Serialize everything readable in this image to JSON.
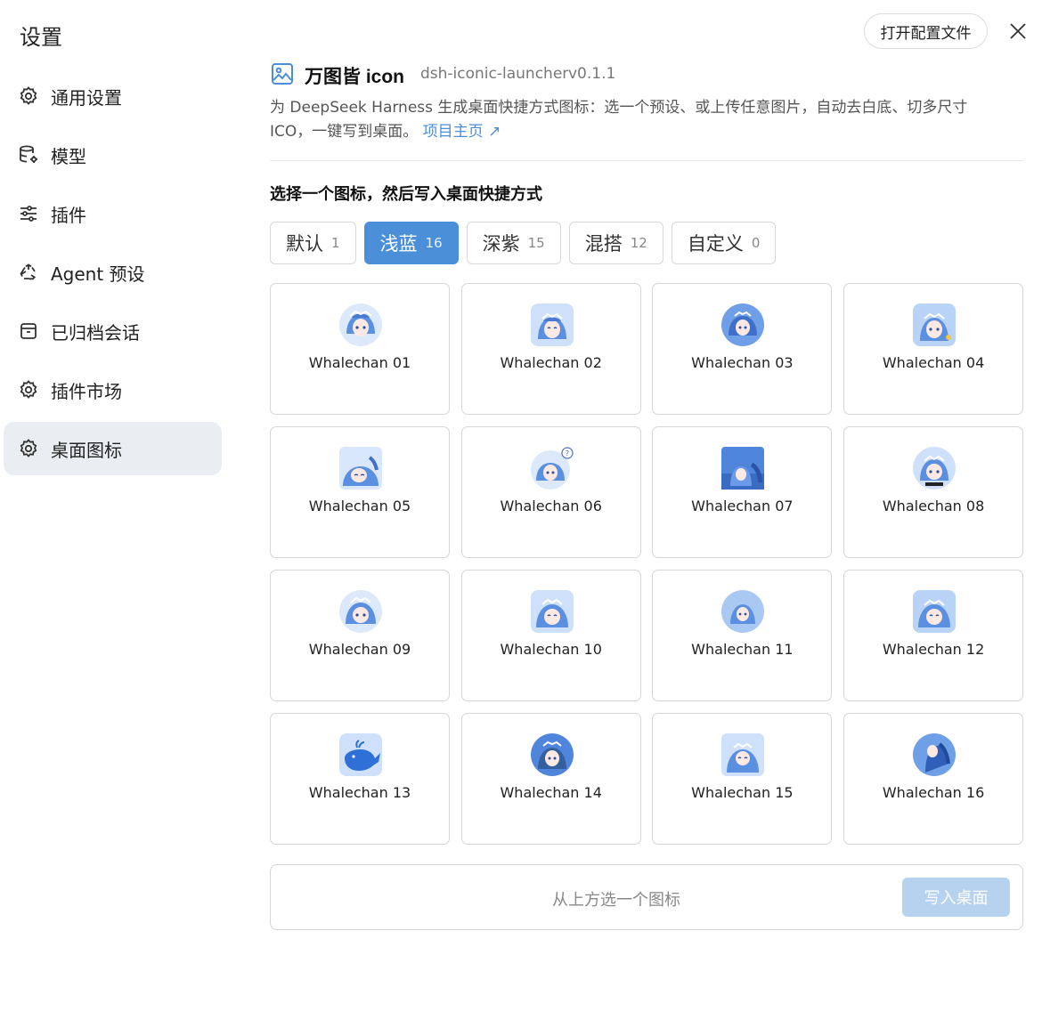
{
  "settings": {
    "title": "设置"
  },
  "sidebar": {
    "items": [
      {
        "label": "通用设置",
        "icon": "gear-icon"
      },
      {
        "label": "模型",
        "icon": "database-gear-icon"
      },
      {
        "label": "插件",
        "icon": "sliders-icon"
      },
      {
        "label": "Agent 预设",
        "icon": "recycle-icon"
      },
      {
        "label": "已归档会话",
        "icon": "archive-icon"
      },
      {
        "label": "插件市场",
        "icon": "gear-icon"
      },
      {
        "label": "桌面图标",
        "icon": "gear-icon",
        "active": true
      }
    ]
  },
  "toolbar": {
    "open_config_label": "打开配置文件"
  },
  "plugin": {
    "name": "万图皆 icon",
    "id": "dsh-iconic-launcher",
    "version": "v0.1.1",
    "description": "为 DeepSeek Harness 生成桌面快捷方式图标：选一个预设、或上传任意图片，自动去白底、切多尺寸 ICO，一键写到桌面。",
    "link_label": "项目主页 ↗"
  },
  "section": {
    "title": "选择一个图标，然后写入桌面快捷方式"
  },
  "tabs": [
    {
      "label": "默认",
      "count": "1"
    },
    {
      "label": "浅蓝",
      "count": "16",
      "active": true
    },
    {
      "label": "深紫",
      "count": "15"
    },
    {
      "label": "混搭",
      "count": "12"
    },
    {
      "label": "自定义",
      "count": "0"
    }
  ],
  "icons": [
    {
      "name": "Whalechan 01"
    },
    {
      "name": "Whalechan 02"
    },
    {
      "name": "Whalechan 03"
    },
    {
      "name": "Whalechan 04"
    },
    {
      "name": "Whalechan 05"
    },
    {
      "name": "Whalechan 06"
    },
    {
      "name": "Whalechan 07"
    },
    {
      "name": "Whalechan 08"
    },
    {
      "name": "Whalechan 09"
    },
    {
      "name": "Whalechan 10"
    },
    {
      "name": "Whalechan 11"
    },
    {
      "name": "Whalechan 12"
    },
    {
      "name": "Whalechan 13"
    },
    {
      "name": "Whalechan 14"
    },
    {
      "name": "Whalechan 15"
    },
    {
      "name": "Whalechan 16"
    }
  ],
  "bottom": {
    "hint": "从上方选一个图标",
    "write_label": "写入桌面"
  },
  "colors": {
    "accent": "#4a8fd8",
    "accent_disabled": "#b6d2ef",
    "active_nav": "#eaedf1"
  }
}
